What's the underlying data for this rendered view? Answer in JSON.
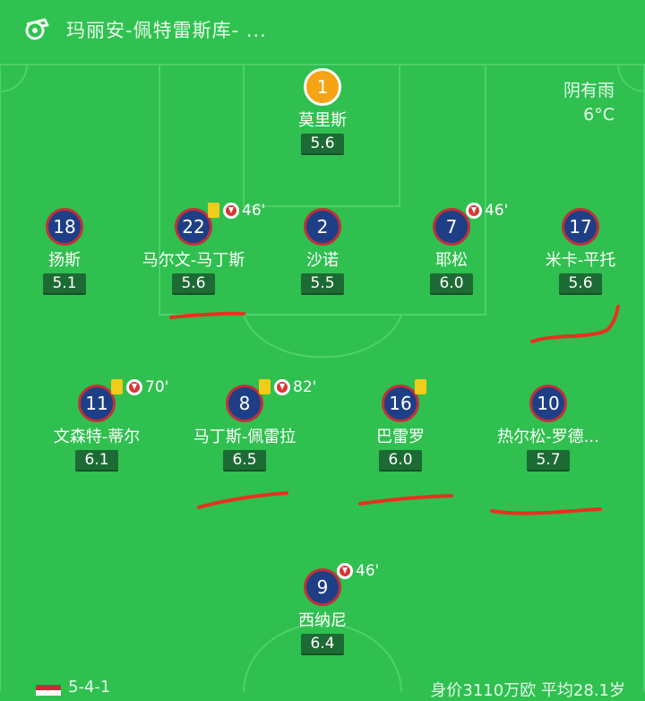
{
  "header": {
    "team_title": "玛丽安-佩特雷斯库- ...",
    "whistle_icon": "whistle-icon"
  },
  "weather": {
    "condition": "阴有雨",
    "temperature": "6°C"
  },
  "colors": {
    "pitch": "#2fc04f",
    "player_circle": "#1e3f86",
    "player_border": "#c2303a",
    "goalkeeper": "#f6a315",
    "rating_bg": "#1d6b34",
    "yellow_card": "#f2cc18",
    "sub_out": "#d93536",
    "annotation": "#e8311f"
  },
  "players": [
    {
      "number": "1",
      "name": "莫里斯",
      "rating": "5.6",
      "goalkeeper": true,
      "yellow": false,
      "sub_out": false,
      "minute": ""
    },
    {
      "number": "18",
      "name": "扬斯",
      "rating": "5.1",
      "goalkeeper": false,
      "yellow": false,
      "sub_out": false,
      "minute": ""
    },
    {
      "number": "22",
      "name": "马尔文-马丁斯",
      "rating": "5.6",
      "goalkeeper": false,
      "yellow": true,
      "sub_out": true,
      "minute": "46'"
    },
    {
      "number": "2",
      "name": "沙诺",
      "rating": "5.5",
      "goalkeeper": false,
      "yellow": false,
      "sub_out": false,
      "minute": ""
    },
    {
      "number": "7",
      "name": "耶松",
      "rating": "6.0",
      "goalkeeper": false,
      "yellow": false,
      "sub_out": true,
      "minute": "46'"
    },
    {
      "number": "17",
      "name": "米卡-平托",
      "rating": "5.6",
      "goalkeeper": false,
      "yellow": false,
      "sub_out": false,
      "minute": ""
    },
    {
      "number": "11",
      "name": "文森特-蒂尔",
      "rating": "6.1",
      "goalkeeper": false,
      "yellow": true,
      "sub_out": true,
      "minute": "70'"
    },
    {
      "number": "8",
      "name": "马丁斯-佩雷拉",
      "rating": "6.5",
      "goalkeeper": false,
      "yellow": true,
      "sub_out": true,
      "minute": "82'"
    },
    {
      "number": "16",
      "name": "巴雷罗",
      "rating": "6.0",
      "goalkeeper": false,
      "yellow": true,
      "sub_out": false,
      "minute": ""
    },
    {
      "number": "10",
      "name": "热尔松-罗德...",
      "rating": "5.7",
      "goalkeeper": false,
      "yellow": false,
      "sub_out": false,
      "minute": ""
    },
    {
      "number": "9",
      "name": "西纳尼",
      "rating": "6.4",
      "goalkeeper": false,
      "yellow": false,
      "sub_out": true,
      "minute": "46'"
    }
  ],
  "footer": {
    "formation": "5-4-1",
    "value_info": "身价3110万欧  平均28.1岁"
  }
}
